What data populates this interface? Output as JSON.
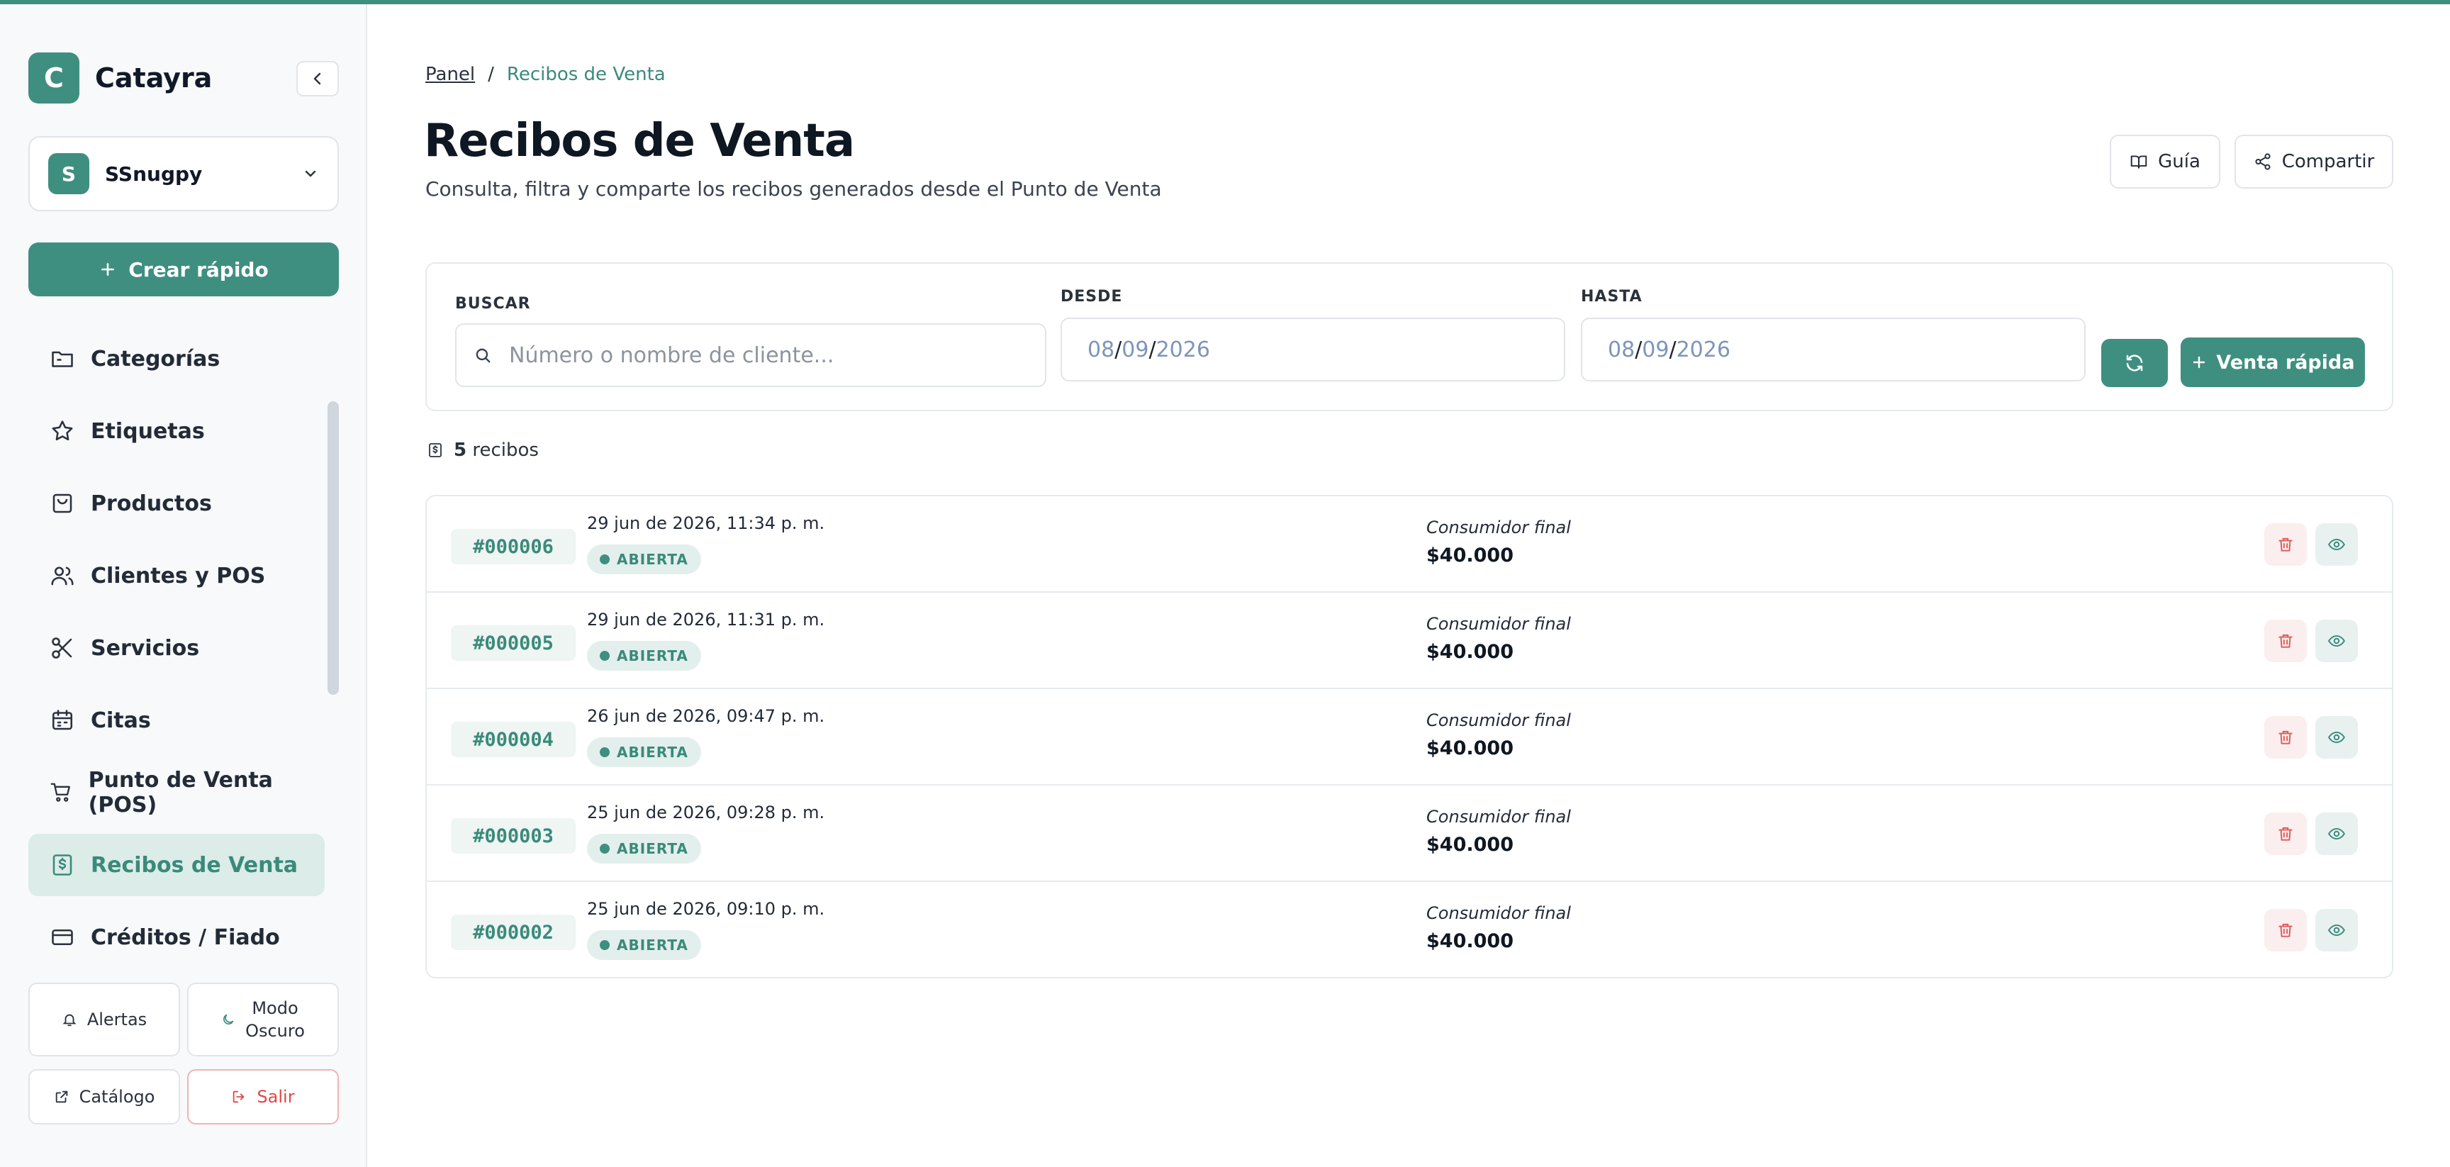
{
  "app": {
    "brand_initial": "C",
    "brand_name": "Catayra",
    "accent_color": "#3f8f80"
  },
  "workspace": {
    "initial": "S",
    "name": "SSnugpy"
  },
  "sidebar": {
    "create_label": "Crear rápido",
    "items": [
      {
        "label": "Categorías",
        "icon": "folder-icon"
      },
      {
        "label": "Etiquetas",
        "icon": "star-icon"
      },
      {
        "label": "Productos",
        "icon": "shopping-bag-icon"
      },
      {
        "label": "Clientes y POS",
        "icon": "users-icon"
      },
      {
        "label": "Servicios",
        "icon": "scissors-icon"
      },
      {
        "label": "Citas",
        "icon": "calendar-icon"
      },
      {
        "label": "Punto de Venta (POS)",
        "icon": "cart-icon"
      },
      {
        "label": "Recibos de Venta",
        "icon": "receipt-icon",
        "active": true
      },
      {
        "label": "Créditos / Fiado",
        "icon": "credit-card-icon"
      }
    ],
    "alerts_label": "Alertas",
    "dark_mode_label_1": "Modo",
    "dark_mode_label_2": "Oscuro",
    "catalog_label": "Catálogo",
    "exit_label": "Salir"
  },
  "breadcrumb": {
    "home": "Panel",
    "separator": "/",
    "current": "Recibos de Venta"
  },
  "header": {
    "title": "Recibos de Venta",
    "subtitle": "Consulta, filtra y comparte los recibos generados desde el Punto de Venta",
    "guide_label": "Guía",
    "share_label": "Compartir"
  },
  "filters": {
    "search_label": "BUSCAR",
    "search_placeholder": "Número o nombre de cliente...",
    "from_label": "DESDE",
    "to_label": "HASTA",
    "from_date": {
      "mm": "08",
      "dd": "09",
      "yyyy": "2026"
    },
    "to_date": {
      "mm": "08",
      "dd": "09",
      "yyyy": "2026"
    },
    "quick_sale_label": "Venta rápida"
  },
  "summary": {
    "count": "5",
    "count_suffix": "recibos"
  },
  "receipts": [
    {
      "number": "#000006",
      "date": "29 jun de 2026, 11:34 p. m.",
      "status": "ABIERTA",
      "customer": "Consumidor final",
      "amount": "$40.000"
    },
    {
      "number": "#000005",
      "date": "29 jun de 2026, 11:31 p. m.",
      "status": "ABIERTA",
      "customer": "Consumidor final",
      "amount": "$40.000"
    },
    {
      "number": "#000004",
      "date": "26 jun de 2026, 09:47 p. m.",
      "status": "ABIERTA",
      "customer": "Consumidor final",
      "amount": "$40.000"
    },
    {
      "number": "#000003",
      "date": "25 jun de 2026, 09:28 p. m.",
      "status": "ABIERTA",
      "customer": "Consumidor final",
      "amount": "$40.000"
    },
    {
      "number": "#000002",
      "date": "25 jun de 2026, 09:10 p. m.",
      "status": "ABIERTA",
      "customer": "Consumidor final",
      "amount": "$40.000"
    }
  ]
}
